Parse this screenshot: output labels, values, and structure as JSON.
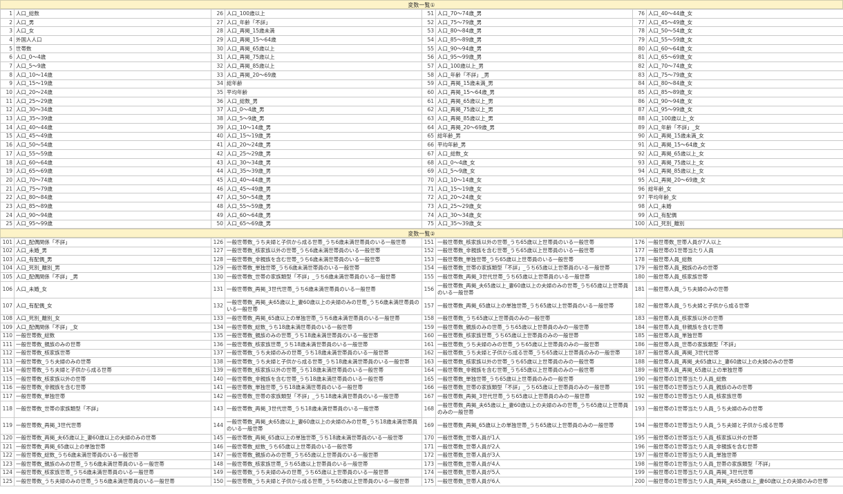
{
  "section1": {
    "title": "変数一覧①",
    "rows": [
      [
        [
          1,
          "人口_総数"
        ],
        [
          26,
          "人口_100歳以上"
        ],
        [
          51,
          "人口_70～74歳_男"
        ],
        [
          76,
          "人口_40～44歳_女"
        ]
      ],
      [
        [
          2,
          "人口_男"
        ],
        [
          27,
          "人口_年齢「不詳」"
        ],
        [
          52,
          "人口_75～79歳_男"
        ],
        [
          77,
          "人口_45～49歳_女"
        ]
      ],
      [
        [
          3,
          "人口_女"
        ],
        [
          28,
          "人口_再掲_15歳未満"
        ],
        [
          53,
          "人口_80～84歳_男"
        ],
        [
          78,
          "人口_50～54歳_女"
        ]
      ],
      [
        [
          4,
          "外国人人口"
        ],
        [
          29,
          "人口_再掲_15～64歳"
        ],
        [
          54,
          "人口_85～89歳_男"
        ],
        [
          79,
          "人口_55～59歳_女"
        ]
      ],
      [
        [
          5,
          "世帯数"
        ],
        [
          30,
          "人口_再掲_65歳以上"
        ],
        [
          55,
          "人口_90～94歳_男"
        ],
        [
          80,
          "人口_60～64歳_女"
        ]
      ],
      [
        [
          6,
          "人口_0～4歳"
        ],
        [
          31,
          "人口_再掲_75歳以上"
        ],
        [
          56,
          "人口_95～99歳_男"
        ],
        [
          81,
          "人口_65～69歳_女"
        ]
      ],
      [
        [
          7,
          "人口_5～9歳"
        ],
        [
          32,
          "人口_再掲_85歳以上"
        ],
        [
          57,
          "人口_100歳以上_男"
        ],
        [
          82,
          "人口_70～74歳_女"
        ]
      ],
      [
        [
          8,
          "人口_10～14歳"
        ],
        [
          33,
          "人口_再掲_20～69歳"
        ],
        [
          58,
          "人口_年齢「不詳」_男"
        ],
        [
          83,
          "人口_75～79歳_女"
        ]
      ],
      [
        [
          9,
          "人口_15～19歳"
        ],
        [
          34,
          "総年齢"
        ],
        [
          59,
          "人口_再掲_15歳未満_男"
        ],
        [
          84,
          "人口_80～84歳_女"
        ]
      ],
      [
        [
          10,
          "人口_20～24歳"
        ],
        [
          35,
          "平均年齢"
        ],
        [
          60,
          "人口_再掲_15～64歳_男"
        ],
        [
          85,
          "人口_85～89歳_女"
        ]
      ],
      [
        [
          11,
          "人口_25～29歳"
        ],
        [
          36,
          "人口_総数_男"
        ],
        [
          61,
          "人口_再掲_65歳以上_男"
        ],
        [
          86,
          "人口_90～94歳_女"
        ]
      ],
      [
        [
          12,
          "人口_30～34歳"
        ],
        [
          37,
          "人口_0～4歳_男"
        ],
        [
          62,
          "人口_再掲_75歳以上_男"
        ],
        [
          87,
          "人口_95～99歳_女"
        ]
      ],
      [
        [
          13,
          "人口_35～39歳"
        ],
        [
          38,
          "人口_5～9歳_男"
        ],
        [
          63,
          "人口_再掲_85歳以上_男"
        ],
        [
          88,
          "人口_100歳以上_女"
        ]
      ],
      [
        [
          14,
          "人口_40～44歳"
        ],
        [
          39,
          "人口_10～14歳_男"
        ],
        [
          64,
          "人口_再掲_20～69歳_男"
        ],
        [
          89,
          "人口_年齢「不詳」_女"
        ]
      ],
      [
        [
          15,
          "人口_45～49歳"
        ],
        [
          40,
          "人口_15～19歳_男"
        ],
        [
          65,
          "総年齢_男"
        ],
        [
          90,
          "人口_再掲_15歳未満_女"
        ]
      ],
      [
        [
          16,
          "人口_50～54歳"
        ],
        [
          41,
          "人口_20～24歳_男"
        ],
        [
          66,
          "平均年齢_男"
        ],
        [
          91,
          "人口_再掲_15～64歳_女"
        ]
      ],
      [
        [
          17,
          "人口_55～59歳"
        ],
        [
          42,
          "人口_25～29歳_男"
        ],
        [
          67,
          "人口_総数_女"
        ],
        [
          92,
          "人口_再掲_65歳以上_女"
        ]
      ],
      [
        [
          18,
          "人口_60～64歳"
        ],
        [
          43,
          "人口_30～34歳_男"
        ],
        [
          68,
          "人口_0～4歳_女"
        ],
        [
          93,
          "人口_再掲_75歳以上_女"
        ]
      ],
      [
        [
          19,
          "人口_65～69歳"
        ],
        [
          44,
          "人口_35～39歳_男"
        ],
        [
          69,
          "人口_5～9歳_女"
        ],
        [
          94,
          "人口_再掲_85歳以上_女"
        ]
      ],
      [
        [
          20,
          "人口_70～74歳"
        ],
        [
          45,
          "人口_40～44歳_男"
        ],
        [
          70,
          "人口_10～14歳_女"
        ],
        [
          95,
          "人口_再掲_20～69歳_女"
        ]
      ],
      [
        [
          21,
          "人口_75～79歳"
        ],
        [
          46,
          "人口_45～49歳_男"
        ],
        [
          71,
          "人口_15～19歳_女"
        ],
        [
          96,
          "総年齢_女"
        ]
      ],
      [
        [
          22,
          "人口_80～84歳"
        ],
        [
          47,
          "人口_50～54歳_男"
        ],
        [
          72,
          "人口_20～24歳_女"
        ],
        [
          97,
          "平均年齢_女"
        ]
      ],
      [
        [
          23,
          "人口_85～89歳"
        ],
        [
          48,
          "人口_55～59歳_男"
        ],
        [
          73,
          "人口_25～29歳_女"
        ],
        [
          98,
          "人口_未婚"
        ]
      ],
      [
        [
          24,
          "人口_90～94歳"
        ],
        [
          49,
          "人口_60～64歳_男"
        ],
        [
          74,
          "人口_30～34歳_女"
        ],
        [
          99,
          "人口_有配偶"
        ]
      ],
      [
        [
          25,
          "人口_95～99歳"
        ],
        [
          50,
          "人口_65～69歳_男"
        ],
        [
          75,
          "人口_35～39歳_女"
        ],
        [
          100,
          "人口_死別_離別"
        ]
      ]
    ]
  },
  "section2": {
    "title": "変数一覧②",
    "rows": [
      [
        [
          101,
          "人口_配偶関係「不詳」"
        ],
        [
          126,
          "一般世帯数_うち夫婦と子供から成る世帯_うち6歳未満世帯員のいる一般世帯"
        ],
        [
          151,
          "一般世帯数_核家族以外の世帯_うち65歳以上世帯員のいる一般世帯"
        ],
        [
          176,
          "一般世帯数_世帯人員が7人以上"
        ]
      ],
      [
        [
          102,
          "人口_未婚_男"
        ],
        [
          127,
          "一般世帯数_核家族以外の世帯_うち6歳未満世帯員のいる一般世帯"
        ],
        [
          152,
          "一般世帯数_非親族を含む世帯_うち65歳以上世帯員のいる一般世帯"
        ],
        [
          177,
          "一般世帯の1世帯当たり人員"
        ]
      ],
      [
        [
          103,
          "人口_有配偶_男"
        ],
        [
          128,
          "一般世帯数_非親族を含む世帯_うち6歳未満世帯員のいる一般世帯"
        ],
        [
          153,
          "一般世帯数_単独世帯_うち65歳以上世帯員のいる一般世帯"
        ],
        [
          178,
          "一般世帯人員_総数"
        ]
      ],
      [
        [
          104,
          "人口_死別_離別_男"
        ],
        [
          129,
          "一般世帯数_単独世帯_うち6歳未満世帯員のいる一般世帯"
        ],
        [
          154,
          "一般世帯数_世帯の家族類型「不詳」_うち65歳以上世帯員のいる一般世帯"
        ],
        [
          179,
          "一般世帯人員_親族のみの世帯"
        ]
      ],
      [
        [
          105,
          "人口_配偶関係「不詳」_男"
        ],
        [
          130,
          "一般世帯数_世帯の家族類型「不詳」_うち6歳未満世帯員のいる一般世帯"
        ],
        [
          155,
          "一般世帯数_再掲_3世代世帯_うち65歳以上世帯員のいる一般世帯"
        ],
        [
          180,
          "一般世帯人員_核家族世帯"
        ]
      ],
      [
        [
          106,
          "人口_未婚_女"
        ],
        [
          131,
          "一般世帯数_再掲_3世代世帯_うち6歳未満世帯員のいる一般世帯"
        ],
        [
          156,
          "一般世帯数_再掲_夫65歳以上_妻60歳以上の夫婦のみの世帯_うち65歳以上世帯員のいる一般世帯"
        ],
        [
          181,
          "一般世帯人員_うち夫婦のみの世帯"
        ]
      ],
      [
        [
          107,
          "人口_有配偶_女"
        ],
        [
          132,
          "一般世帯数_再掲_夫65歳以上_妻60歳以上の夫婦のみの世帯_うち6歳未満世帯員のいる一般世帯"
        ],
        [
          157,
          "一般世帯数_再掲_65歳以上の単独世帯_うち65歳以上世帯員のいる一般世帯"
        ],
        [
          182,
          "一般世帯人員_うち夫婦と子供から成る世帯"
        ]
      ],
      [
        [
          108,
          "人口_死別_離別_女"
        ],
        [
          133,
          "一般世帯数_再掲_65歳以上の単独世帯_うち6歳未満世帯員のいる一般世帯"
        ],
        [
          158,
          "一般世帯数_うち65歳以上世帯員のみの一般世帯"
        ],
        [
          183,
          "一般世帯人員_核家族以外の世帯"
        ]
      ],
      [
        [
          109,
          "人口_配偶関係「不詳」_女"
        ],
        [
          134,
          "一般世帯数_総数_うち18歳未満世帯員のいる一般世帯"
        ],
        [
          159,
          "一般世帯数_親族のみの世帯_うち65歳以上世帯員のみの一般世帯"
        ],
        [
          184,
          "一般世帯人員_非親族を含む世帯"
        ]
      ],
      [
        [
          110,
          "一般世帯数_総数"
        ],
        [
          135,
          "一般世帯数_親族のみの世帯_うち18歳未満世帯員のいる一般世帯"
        ],
        [
          160,
          "一般世帯数_核家族世帯_うち65歳以上世帯員のみの一般世帯"
        ],
        [
          185,
          "一般世帯人員_単独世帯"
        ]
      ],
      [
        [
          111,
          "一般世帯数_親族のみの世帯"
        ],
        [
          136,
          "一般世帯数_核家族世帯_うち18歳未満世帯員のいる一般世帯"
        ],
        [
          161,
          "一般世帯数_うち夫婦のみの世帯_うち65歳以上世帯員のみの一般世帯"
        ],
        [
          186,
          "一般世帯人員_世帯の家族類型「不詳」"
        ]
      ],
      [
        [
          112,
          "一般世帯数_核家族世帯"
        ],
        [
          137,
          "一般世帯数_うち夫婦のみの世帯_うち18歳未満世帯員のいる一般世帯"
        ],
        [
          162,
          "一般世帯数_うち夫婦と子供から成る世帯_うち65歳以上世帯員のみの一般世帯"
        ],
        [
          187,
          "一般世帯人員_再掲_3世代世帯"
        ]
      ],
      [
        [
          113,
          "一般世帯数_うち夫婦のみの世帯"
        ],
        [
          138,
          "一般世帯数_うち夫婦と子供から成る世帯_うち18歳未満世帯員のいる一般世帯"
        ],
        [
          163,
          "一般世帯数_核家族以外の世帯_うち65歳以上世帯員のみの一般世帯"
        ],
        [
          188,
          "一般世帯人員_再掲_夫65歳以上_妻60歳以上の夫婦のみの世帯"
        ]
      ],
      [
        [
          114,
          "一般世帯数_うち夫婦と子供から成る世帯"
        ],
        [
          139,
          "一般世帯数_核家族以外の世帯_うち18歳未満世帯員のいる一般世帯"
        ],
        [
          164,
          "一般世帯数_非親族を含む世帯_うち65歳以上世帯員のみの一般世帯"
        ],
        [
          189,
          "一般世帯人員_再掲_65歳以上の単独世帯"
        ]
      ],
      [
        [
          115,
          "一般世帯数_核家族以外の世帯"
        ],
        [
          140,
          "一般世帯数_非親族を含む世帯_うち18歳未満世帯員のいる一般世帯"
        ],
        [
          165,
          "一般世帯数_単独世帯_うち65歳以上世帯員のみの一般世帯"
        ],
        [
          190,
          "一般世帯の1世帯当たり人員_総数"
        ]
      ],
      [
        [
          116,
          "一般世帯数_非親族を含む世帯"
        ],
        [
          141,
          "一般世帯数_単独世帯_うち18歳未満世帯員のいる一般世帯"
        ],
        [
          166,
          "一般世帯数_世帯の家族類型「不詳」_うち65歳以上世帯員のみの一般世帯"
        ],
        [
          191,
          "一般世帯の1世帯当たり人員_親族のみの世帯"
        ]
      ],
      [
        [
          117,
          "一般世帯数_単独世帯"
        ],
        [
          142,
          "一般世帯数_世帯の家族類型「不詳」_うち18歳未満世帯員のいる一般世帯"
        ],
        [
          167,
          "一般世帯数_再掲_3世代世帯_うち65歳以上世帯員のみの一般世帯"
        ],
        [
          192,
          "一般世帯の1世帯当たり人員_核家族世帯"
        ]
      ],
      [
        [
          118,
          "一般世帯数_世帯の家族類型「不詳」"
        ],
        [
          143,
          "一般世帯数_再掲_3世代世帯_うち18歳未満世帯員のいる一般世帯"
        ],
        [
          168,
          "一般世帯数_再掲_夫65歳以上_妻60歳以上の夫婦のみの世帯_うち65歳以上世帯員のみの一般世帯"
        ],
        [
          193,
          "一般世帯の1世帯当たり人員_うち夫婦のみの世帯"
        ]
      ],
      [
        [
          119,
          "一般世帯数_再掲_3世代世帯"
        ],
        [
          144,
          "一般世帯数_再掲_夫65歳以上_妻60歳以上の夫婦のみの世帯_うち18歳未満世帯員のいる一般世帯"
        ],
        [
          169,
          "一般世帯数_再掲_65歳以上の単独世帯_うち65歳以上世帯員のみの一般世帯"
        ],
        [
          194,
          "一般世帯の1世帯当たり人員_うち夫婦と子供から成る世帯"
        ]
      ],
      [
        [
          120,
          "一般世帯数_再掲_夫65歳以上_妻60歳以上の夫婦のみの世帯"
        ],
        [
          145,
          "一般世帯数_再掲_65歳以上の単独世帯_うち18歳未満世帯員のいる一般世帯"
        ],
        [
          170,
          "一般世帯数_世帯人員が1人"
        ],
        [
          195,
          "一般世帯の1世帯当たり人員_核家族以外の世帯"
        ]
      ],
      [
        [
          121,
          "一般世帯数_再掲_65歳以上の単独世帯"
        ],
        [
          146,
          "一般世帯数_総数_うち65歳以上世帯員のいる一般世帯"
        ],
        [
          171,
          "一般世帯数_世帯人員が2人"
        ],
        [
          196,
          "一般世帯の1世帯当たり人員_非親族を含む世帯"
        ]
      ],
      [
        [
          122,
          "一般世帯数_総数_うち6歳未満世帯員のいる一般世帯"
        ],
        [
          147,
          "一般世帯数_親族のみの世帯_うち65歳以上世帯員のいる一般世帯"
        ],
        [
          172,
          "一般世帯数_世帯人員が3人"
        ],
        [
          197,
          "一般世帯の1世帯当たり人員_単独世帯"
        ]
      ],
      [
        [
          123,
          "一般世帯数_親族のみの世帯_うち6歳未満世帯員のいる一般世帯"
        ],
        [
          148,
          "一般世帯数_核家族世帯_うち65歳以上世帯員のいる一般世帯"
        ],
        [
          173,
          "一般世帯数_世帯人員が4人"
        ],
        [
          198,
          "一般世帯の1世帯当たり人員_世帯の家族類型「不詳」"
        ]
      ],
      [
        [
          124,
          "一般世帯数_核家族世帯_うち6歳未満世帯員のいる一般世帯"
        ],
        [
          149,
          "一般世帯数_うち夫婦のみの世帯_うち65歳以上世帯員のいる一般世帯"
        ],
        [
          174,
          "一般世帯数_世帯人員が5人"
        ],
        [
          199,
          "一般世帯の1世帯当たり人員_再掲_3世代世帯"
        ]
      ],
      [
        [
          125,
          "一般世帯数_うち夫婦のみの世帯_うち6歳未満世帯員のいる一般世帯"
        ],
        [
          150,
          "一般世帯数_うち夫婦と子供から成る世帯_うち65歳以上世帯員のいる一般世帯"
        ],
        [
          175,
          "一般世帯数_世帯人員が6人"
        ],
        [
          200,
          "一般世帯の1世帯当たり人員_再掲_夫65歳以上_妻60歳以上の夫婦のみの世帯"
        ]
      ]
    ]
  }
}
